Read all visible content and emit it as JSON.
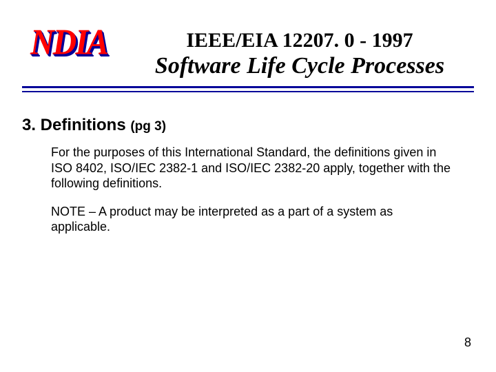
{
  "logo": "NDIA",
  "title": {
    "line1": "IEEE/EIA 12207. 0 - 1997",
    "line2": "Software Life Cycle Processes"
  },
  "section": {
    "number_label": "3.  Definitions ",
    "pg_label": "(pg 3)"
  },
  "body": {
    "para1": "For the purposes of this International Standard, the definitions given in ISO 8402, ISO/IEC 2382-1 and ISO/IEC 2382-20 apply, together with the following definitions.",
    "para2": "NOTE – A product may be interpreted as a part of a system as applicable."
  },
  "page_number": "8"
}
